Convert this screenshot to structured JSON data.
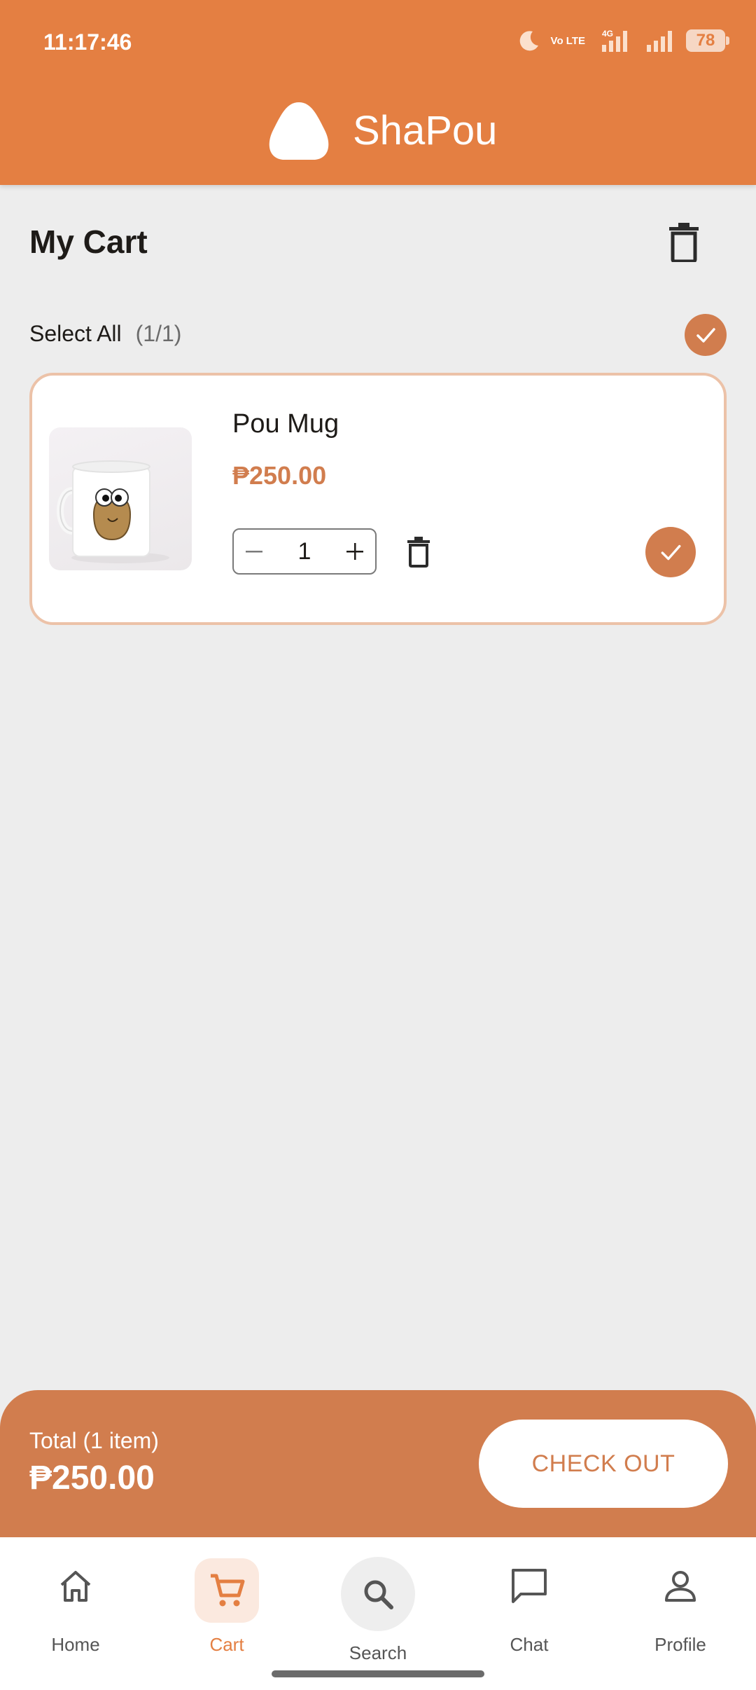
{
  "status_bar": {
    "time": "11:17:46",
    "volte": "Vo LTE",
    "network": "4G",
    "battery": "78"
  },
  "app": {
    "brand_name": "ShaPou",
    "accent_color": "#e47f42",
    "price_color": "#d17d4e"
  },
  "cart": {
    "title": "My Cart",
    "select_all_label": "Select All",
    "select_all_count": "(1/1)",
    "items": [
      {
        "name": "Pou Mug",
        "price": "₱250.00",
        "quantity": "1",
        "selected": true
      }
    ]
  },
  "checkout": {
    "total_label": "Total (1 item)",
    "total_value": "₱250.00",
    "button_label": "CHECK OUT"
  },
  "nav": {
    "items": [
      {
        "label": "Home",
        "icon": "home-icon"
      },
      {
        "label": "Cart",
        "icon": "cart-icon",
        "active": true
      },
      {
        "label": "Search",
        "icon": "search-icon"
      },
      {
        "label": "Chat",
        "icon": "chat-icon"
      },
      {
        "label": "Profile",
        "icon": "profile-icon"
      }
    ]
  }
}
